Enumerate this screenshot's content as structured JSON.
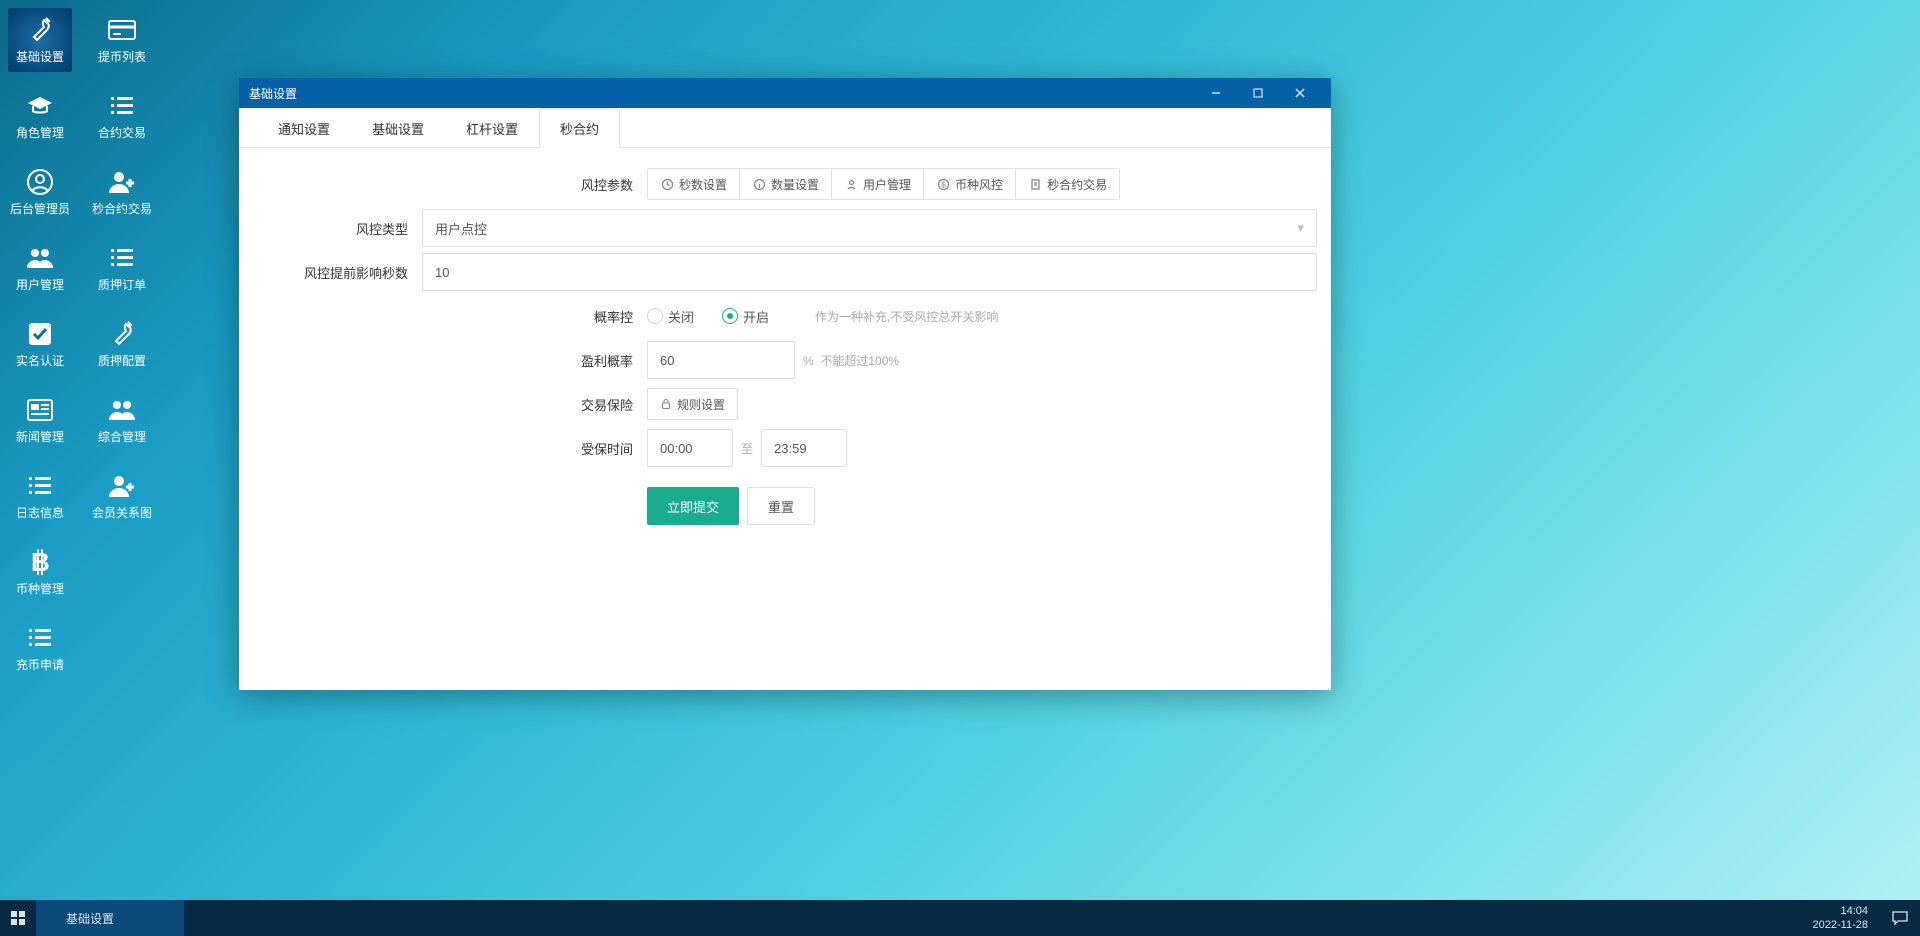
{
  "desktop": {
    "col1": [
      {
        "label": "基础设置",
        "icon": "wrench",
        "active": true
      },
      {
        "label": "角色管理",
        "icon": "grad"
      },
      {
        "label": "后台管理员",
        "icon": "user-circle"
      },
      {
        "label": "用户管理",
        "icon": "users"
      },
      {
        "label": "实名认证",
        "icon": "check-box"
      },
      {
        "label": "新闻管理",
        "icon": "news"
      },
      {
        "label": "日志信息",
        "icon": "list"
      },
      {
        "label": "币种管理",
        "icon": "btc"
      },
      {
        "label": "充币申请",
        "icon": "list"
      }
    ],
    "col2": [
      {
        "label": "提币列表",
        "icon": "card"
      },
      {
        "label": "合约交易",
        "icon": "list"
      },
      {
        "label": "秒合约交易",
        "icon": "user-plus"
      },
      {
        "label": "质押订单",
        "icon": "list"
      },
      {
        "label": "质押配置",
        "icon": "wrench"
      },
      {
        "label": "综合管理",
        "icon": "users"
      },
      {
        "label": "会员关系图",
        "icon": "user-plus"
      }
    ]
  },
  "window": {
    "title": "基础设置",
    "tabs": [
      "通知设置",
      "基础设置",
      "杠杆设置",
      "秒合约"
    ],
    "active_tab": 3,
    "labels": {
      "risk_params": "风控参数",
      "risk_type": "风控类型",
      "advance_sec": "风控提前影响秒数",
      "prob_ctrl": "概率控",
      "profit_prob": "盈利概率",
      "trade_ins": "交易保险",
      "insured_time": "受保时间"
    },
    "toolbar": [
      {
        "label": "秒数设置",
        "icon": "clock"
      },
      {
        "label": "数量设置",
        "icon": "info"
      },
      {
        "label": "用户管理",
        "icon": "person"
      },
      {
        "label": "币种风控",
        "icon": "dollar"
      },
      {
        "label": "秒合约交易",
        "icon": "doc"
      }
    ],
    "values": {
      "risk_type": "用户点控",
      "advance_sec": "10",
      "prob_off_label": "关闭",
      "prob_on_label": "开启",
      "prob_hint": "作为一种补充,不受风控总开关影响",
      "profit_prob": "60",
      "profit_unit": "%",
      "profit_hint": "不能超过100%",
      "rule_btn": "规则设置",
      "time_from": "00:00",
      "time_to": "23:59",
      "time_sep": "至",
      "submit": "立即提交",
      "reset": "重置"
    }
  },
  "taskbar": {
    "item": "基础设置",
    "time": "14:04",
    "date": "2022-11-28"
  }
}
